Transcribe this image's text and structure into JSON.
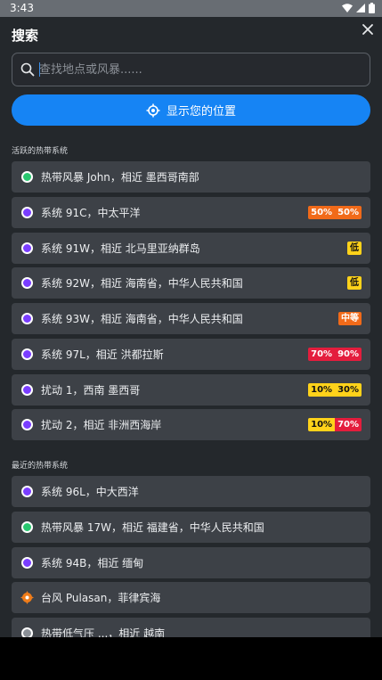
{
  "status": {
    "time": "3:43"
  },
  "header": {
    "title": "搜索"
  },
  "search": {
    "placeholder": "查找地点或风暴......"
  },
  "locate_button": {
    "label": "显示您的位置"
  },
  "active": {
    "title": "活跃的热带系统",
    "items": [
      {
        "label": "热带风暴 John，相近 墨西哥南部",
        "marker": "green",
        "badges": []
      },
      {
        "label": "系统 91C，中太平洋",
        "marker": "purple",
        "badges": [
          {
            "text": "50%",
            "color": "orange"
          },
          {
            "text": "50%",
            "color": "orange"
          }
        ]
      },
      {
        "label": "系统 91W，相近 北马里亚纳群岛",
        "marker": "purple",
        "badges": [
          {
            "text": "低",
            "color": "yellow"
          }
        ]
      },
      {
        "label": "系统 92W，相近 海南省，中华人民共和国",
        "marker": "purple",
        "badges": [
          {
            "text": "低",
            "color": "yellow"
          }
        ]
      },
      {
        "label": "系统 93W，相近 海南省，中华人民共和国",
        "marker": "purple",
        "badges": [
          {
            "text": "中等",
            "color": "orange"
          }
        ]
      },
      {
        "label": "系统 97L，相近 洪都拉斯",
        "marker": "purple",
        "badges": [
          {
            "text": "70%",
            "color": "red"
          },
          {
            "text": "90%",
            "color": "red"
          }
        ]
      },
      {
        "label": "扰动 1，西南 墨西哥",
        "marker": "purple",
        "badges": [
          {
            "text": "10%",
            "color": "yellow"
          },
          {
            "text": "30%",
            "color": "yellow"
          }
        ]
      },
      {
        "label": "扰动 2，相近 非洲西海岸",
        "marker": "purple",
        "badges": [
          {
            "text": "10%",
            "color": "yellow"
          },
          {
            "text": "70%",
            "color": "red"
          }
        ]
      }
    ]
  },
  "recent": {
    "title": "最近的热带系统",
    "items": [
      {
        "label": "系统 96L，中大西洋",
        "marker": "purple"
      },
      {
        "label": "热带风暴 17W，相近 福建省，中华人民共和国",
        "marker": "green"
      },
      {
        "label": "系统 94B，相近 缅甸",
        "marker": "purple"
      },
      {
        "label": "台风 Pulasan，菲律宾海",
        "marker": "orange"
      },
      {
        "label": "热带低气压 ...，相近 越南",
        "marker": "gray"
      }
    ]
  },
  "colors": {
    "accent": "#1684f4",
    "green": "#28c76f",
    "purple": "#7a3dff",
    "orange": "#f16a19",
    "red": "#e41d3d",
    "yellow": "#ffd21a"
  }
}
